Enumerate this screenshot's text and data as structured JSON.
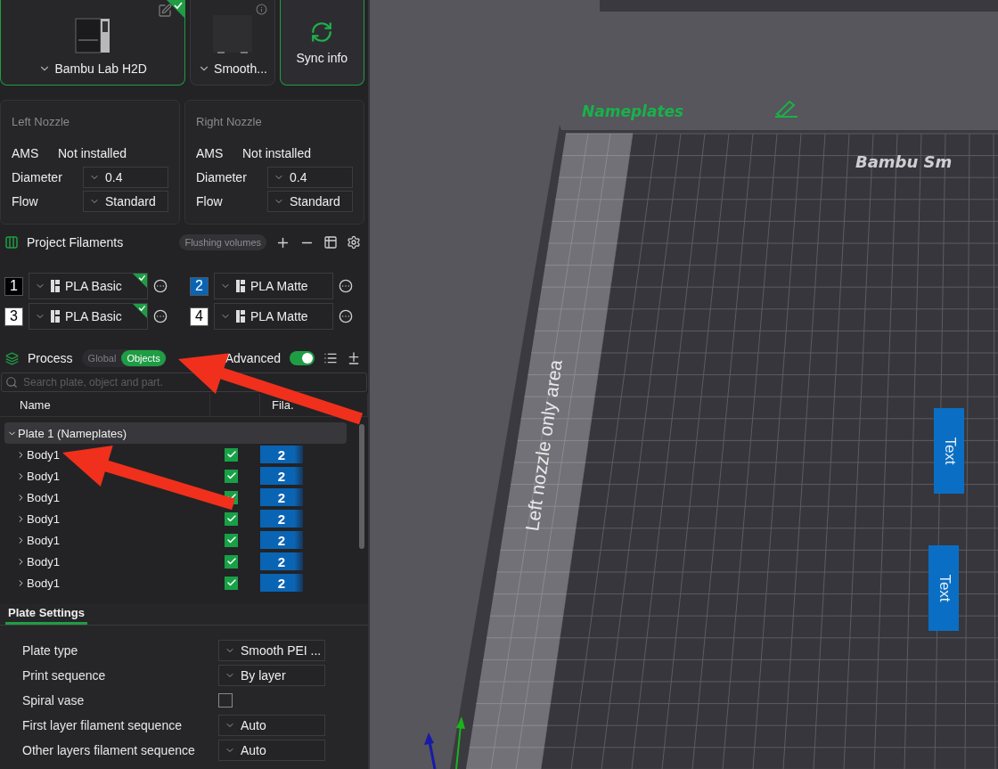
{
  "printer": {
    "name": "Bambu Lab H2D",
    "checked": true
  },
  "plate_card": {
    "name": "Smooth..."
  },
  "sync_button": {
    "label": "Sync info"
  },
  "nozzles": [
    {
      "title": "Left Nozzle",
      "ams_label": "AMS",
      "ams_value": "Not installed",
      "fields": [
        {
          "label": "Diameter",
          "value": "0.4"
        },
        {
          "label": "Flow",
          "value": "Standard"
        }
      ]
    },
    {
      "title": "Right Nozzle",
      "ams_label": "AMS",
      "ams_value": "Not installed",
      "fields": [
        {
          "label": "Diameter",
          "value": "0.4"
        },
        {
          "label": "Flow",
          "value": "Standard"
        }
      ]
    }
  ],
  "project_filaments": {
    "title": "Project Filaments",
    "flushing_button": "Flushing volumes",
    "items": [
      {
        "index": "1",
        "color": "#000000",
        "name": "PLA Basic",
        "synced": true
      },
      {
        "index": "2",
        "color": "#0a64b4",
        "name": "PLA Matte",
        "synced": false
      },
      {
        "index": "3",
        "color": "#ffffff",
        "name": "PLA Basic",
        "synced": true
      },
      {
        "index": "4",
        "color": "#ffffff",
        "name": "PLA Matte",
        "synced": false
      }
    ]
  },
  "process": {
    "title": "Process",
    "modes": [
      {
        "label": "Global",
        "selected": false
      },
      {
        "label": "Objects",
        "selected": true
      }
    ],
    "advanced": {
      "label": "Advanced",
      "on": true
    },
    "search": {
      "placeholder": "Search plate, object and part."
    }
  },
  "object_tree": {
    "columns": [
      "Name",
      "Fila."
    ],
    "plate": {
      "label": "Plate 1 (Nameplates)",
      "expanded": true,
      "children": [
        {
          "label": "Body1",
          "expanded": false,
          "checked": true,
          "filament": "2"
        },
        {
          "label": "Body1",
          "expanded": false,
          "checked": true,
          "filament": "2"
        },
        {
          "label": "Body1",
          "expanded": false,
          "checked": true,
          "filament": "2"
        },
        {
          "label": "Body1",
          "expanded": false,
          "checked": true,
          "filament": "2"
        },
        {
          "label": "Body1",
          "expanded": false,
          "checked": true,
          "filament": "2"
        },
        {
          "label": "Body1",
          "expanded": false,
          "checked": true,
          "filament": "2"
        },
        {
          "label": "Body1",
          "expanded": false,
          "checked": true,
          "filament": "2"
        }
      ]
    }
  },
  "plate_settings": {
    "tab": {
      "label": "Plate Settings",
      "selected": true
    },
    "rows": [
      {
        "kind": "select",
        "label": "Plate type",
        "value": "Smooth PEI ..."
      },
      {
        "kind": "select",
        "label": "Print sequence",
        "value": "By layer"
      },
      {
        "kind": "checkbox",
        "label": "Spiral vase",
        "checked": false
      },
      {
        "kind": "select",
        "label": "First layer filament sequence",
        "value": "Auto"
      },
      {
        "kind": "select",
        "label": "Other layers filament sequence",
        "value": "Auto"
      }
    ]
  },
  "viewport": {
    "plate_name": "Nameplates",
    "bed_label": "Bambu Sm",
    "zone_label": "Left nozzle only area",
    "objects": [
      {
        "label": "Text"
      },
      {
        "label": "Text"
      }
    ]
  }
}
